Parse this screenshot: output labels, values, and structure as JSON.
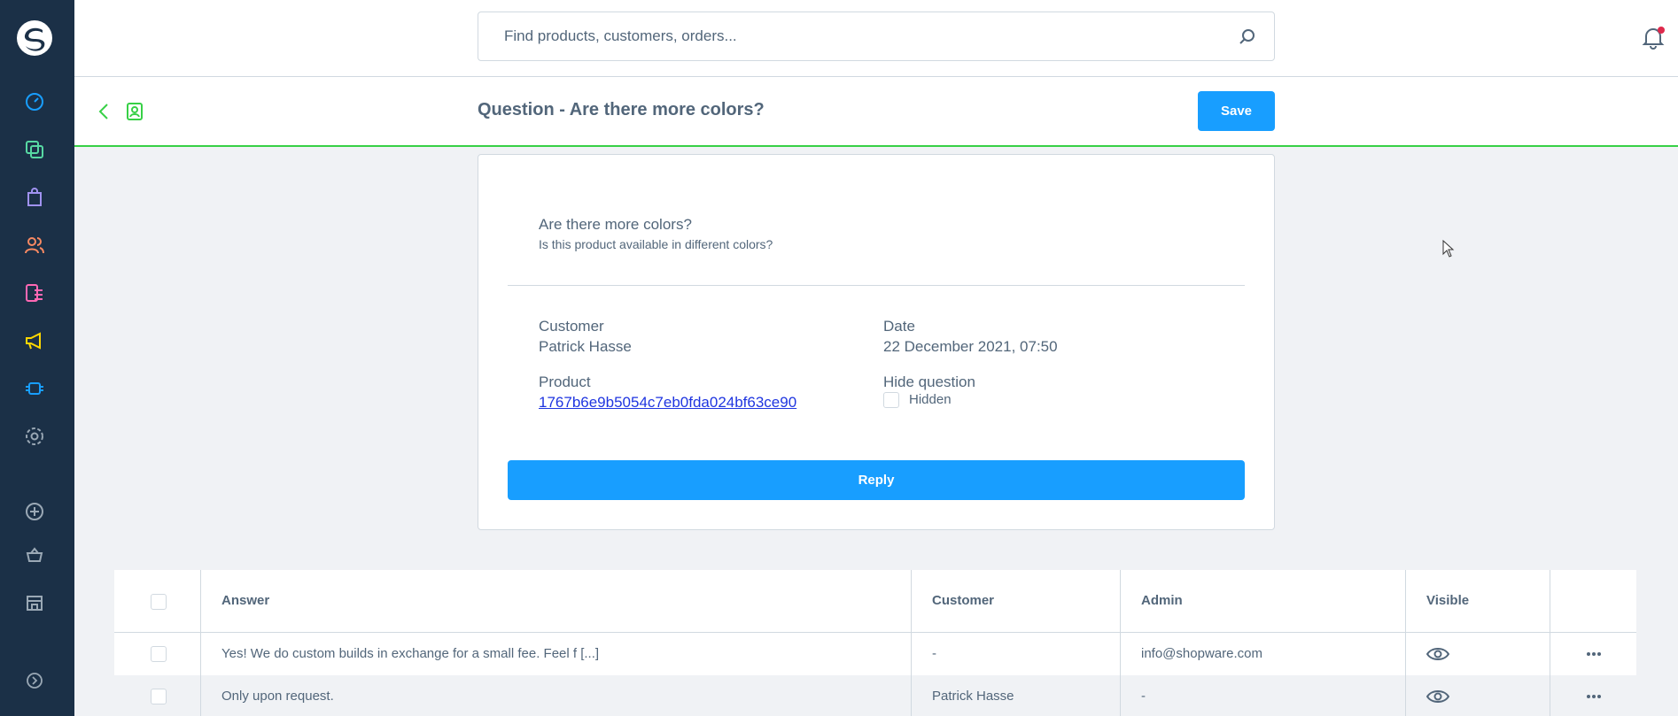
{
  "search": {
    "placeholder": "Find products, customers, orders..."
  },
  "header": {
    "title": "Question - Are there more colors?",
    "save_label": "Save"
  },
  "question": {
    "title": "Are there more colors?",
    "content": "Is this product available in different colors?"
  },
  "details": {
    "customer_label": "Customer",
    "customer_value": "Patrick Hasse",
    "date_label": "Date",
    "date_value": "22 December 2021, 07:50",
    "product_label": "Product",
    "product_value": "1767b6e9b5054c7eb0fda024bf63ce90",
    "hide_label": "Hide question",
    "hidden_checkbox_label": "Hidden"
  },
  "reply_label": "Reply",
  "grid": {
    "columns": [
      "Answer",
      "Customer",
      "Admin",
      "Visible"
    ],
    "rows": [
      {
        "answer": "Yes! We do custom builds in exchange for a small fee. Feel f [...]",
        "customer": "-",
        "admin": "info@shopware.com"
      },
      {
        "answer": "Only upon request.",
        "customer": "Patrick Hasse",
        "admin": "-"
      }
    ]
  },
  "colors": {
    "sidebar_bg": "#1b3047",
    "primary": "#189eff",
    "success_line": "#37d046",
    "text": "#52667a",
    "notification_dot": "#de294c"
  },
  "icons": [
    "shopware-logo",
    "dashboard-icon",
    "catalogue-icon",
    "orders-icon",
    "customers-icon",
    "content-icon",
    "marketing-icon",
    "extensions-icon",
    "settings-icon",
    "add-sales-channel-icon",
    "storefront-icon",
    "headless-icon",
    "collapse-icon",
    "search-icon",
    "bell-icon",
    "back-icon",
    "module-icon",
    "eye-icon",
    "dots-icon"
  ]
}
